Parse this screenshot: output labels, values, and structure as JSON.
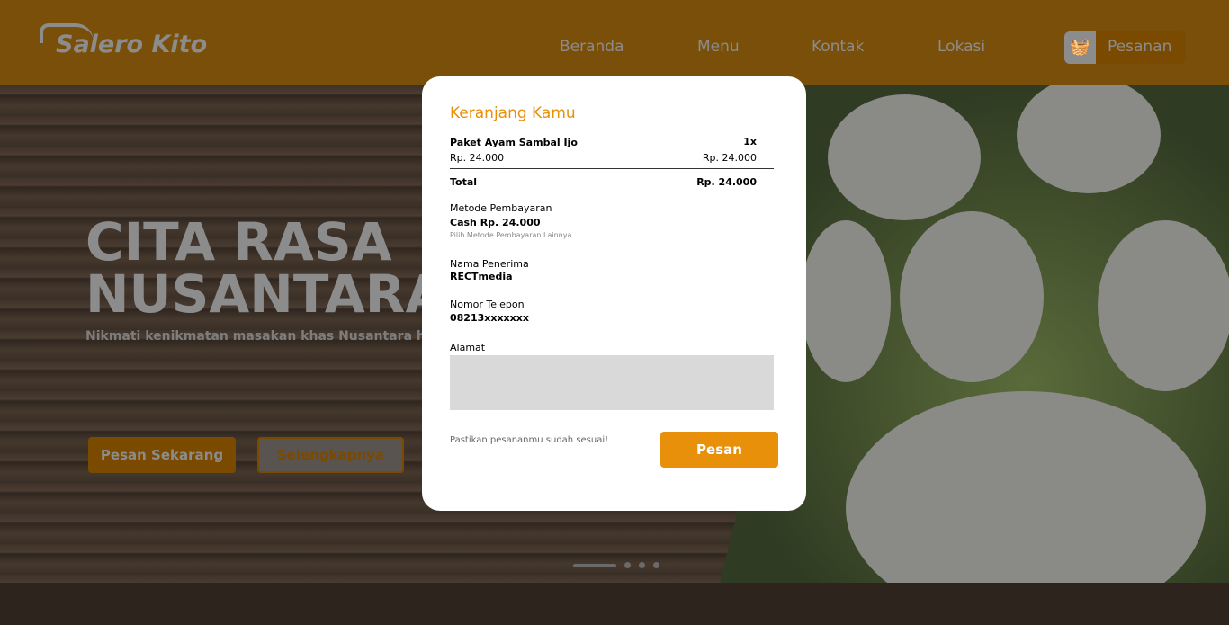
{
  "header": {
    "logo": "Salero Kito",
    "nav": [
      "Beranda",
      "Menu",
      "Kontak",
      "Lokasi"
    ],
    "cart_label": "Pesanan",
    "cart_icon": "basket-icon"
  },
  "hero": {
    "title_line1": "CITA RASA",
    "title_line2": "NUSANTARA",
    "subtitle": "Nikmati kenikmatan masakan khas Nusantara h",
    "primary_button": "Pesan Sekarang",
    "secondary_button": "Selengkapnya"
  },
  "modal": {
    "title": "Keranjang Kamu",
    "item": {
      "name": "Paket Ayam Sambal Ijo",
      "qty": "1x",
      "price": "Rp. 24.000",
      "subtotal": "Rp. 24.000"
    },
    "total_label": "Total",
    "total_value": "Rp. 24.000",
    "payment_label": "Metode Pembayaran",
    "payment_value": "Cash Rp. 24.000",
    "payment_link": "Pilih Metode Pembayaran Lainnya",
    "recipient_label": "Nama Penerima",
    "recipient_value": "RECTmedia",
    "phone_label": "Nomor Telepon",
    "phone_value": "08213xxxxxxx",
    "address_label": "Alamat",
    "address_value": "",
    "note": "Pastikan pesananmu sudah sesuai!",
    "order_button": "Pesan"
  },
  "colors": {
    "accent": "#e8900a"
  }
}
